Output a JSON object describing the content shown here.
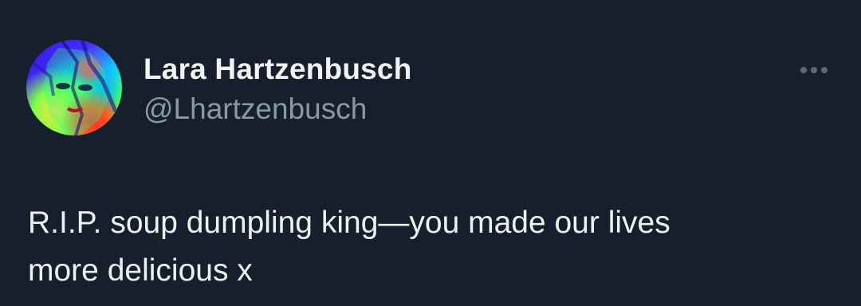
{
  "author": {
    "display_name": "Lara Hartzenbusch",
    "handle": "@Lhartzenbusch"
  },
  "menu": {
    "icon": "more-horizontal-icon"
  },
  "tweet": {
    "line1": "R.I.P. soup dumpling king—you made our lives",
    "line2": "more delicious x"
  },
  "colors": {
    "background": "#16202c",
    "primary_text": "#e7e9ea",
    "secondary_text": "#8b98a5"
  }
}
